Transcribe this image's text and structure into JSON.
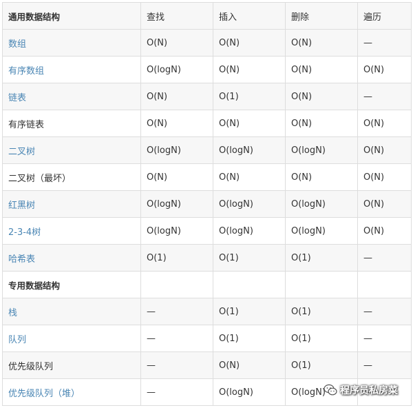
{
  "table": {
    "columns": [
      "通用数据结构",
      "查找",
      "插入",
      "删除",
      "遍历"
    ],
    "rows": [
      {
        "name": "数组",
        "link": true,
        "header": false,
        "cells": [
          "O(N)",
          "O(N)",
          "O(N)",
          "—"
        ]
      },
      {
        "name": "有序数组",
        "link": true,
        "header": false,
        "cells": [
          "O(logN)",
          "O(N)",
          "O(N)",
          "O(N)"
        ]
      },
      {
        "name": "链表",
        "link": true,
        "header": false,
        "cells": [
          "O(N)",
          "O(1)",
          "O(N)",
          "—"
        ]
      },
      {
        "name": "有序链表",
        "link": false,
        "header": false,
        "cells": [
          "O(N)",
          "O(N)",
          "O(N)",
          "O(N)"
        ]
      },
      {
        "name": "二叉树",
        "link": true,
        "header": false,
        "cells": [
          "O(logN)",
          "O(logN)",
          "O(logN)",
          "O(N)"
        ]
      },
      {
        "name": "二叉树（最坏）",
        "link": false,
        "header": false,
        "cells": [
          "O(N)",
          "O(N)",
          "O(N)",
          "O(N)"
        ]
      },
      {
        "name": "红黑树",
        "link": true,
        "header": false,
        "cells": [
          "O(logN)",
          "O(logN)",
          "O(logN)",
          "O(N)"
        ]
      },
      {
        "name": "2-3-4树",
        "link": true,
        "header": false,
        "cells": [
          "O(logN)",
          "O(logN)",
          "O(logN)",
          "O(N)"
        ]
      },
      {
        "name": "哈希表",
        "link": true,
        "header": false,
        "cells": [
          "O(1)",
          "O(1)",
          "O(1)",
          "—"
        ]
      },
      {
        "name": "专用数据结构",
        "link": false,
        "header": true,
        "cells": [
          "",
          "",
          "",
          ""
        ]
      },
      {
        "name": "栈",
        "link": true,
        "header": false,
        "cells": [
          "—",
          "O(1)",
          "O(1)",
          "—"
        ]
      },
      {
        "name": "队列",
        "link": true,
        "header": false,
        "cells": [
          "—",
          "O(1)",
          "O(1)",
          "—"
        ]
      },
      {
        "name": "优先级队列",
        "link": false,
        "header": false,
        "cells": [
          "—",
          "O(N)",
          "O(1)",
          "—"
        ]
      },
      {
        "name": "优先级队列（堆）",
        "link": true,
        "header": false,
        "cells": [
          "—",
          "O(logN)",
          "O(logN)",
          "—"
        ]
      }
    ]
  },
  "watermark": {
    "text": "程序员私房菜",
    "icon": "wechat-icon"
  }
}
